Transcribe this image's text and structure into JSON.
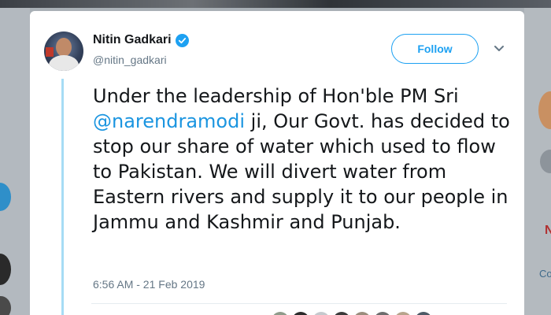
{
  "tweet": {
    "author_name": "Nitin Gadkari",
    "author_handle": "@nitin_gadkari",
    "follow_label": "Follow",
    "text_before": "Under the leadership of Hon'ble PM Sri ",
    "mention": "@narendramodi",
    "text_after": " ji, Our Govt. has decided to stop our share of water which used to flow to Pakistan. We will divert water from Eastern rivers and supply it to our people in Jammu and Kashmir and Punjab.",
    "timestamp": "6:56 AM - 21 Feb 2019"
  },
  "background": {
    "right_link_fragment": "Co",
    "right_red_fragment": "N"
  },
  "colors": {
    "accent": "#1da1f2",
    "mention": "#1b95e0",
    "text": "#14171a",
    "secondary_text": "#657786",
    "thread_line": "#a6dcf5"
  },
  "icons": {
    "verified": "verified-badge-icon",
    "more": "chevron-down-icon"
  }
}
